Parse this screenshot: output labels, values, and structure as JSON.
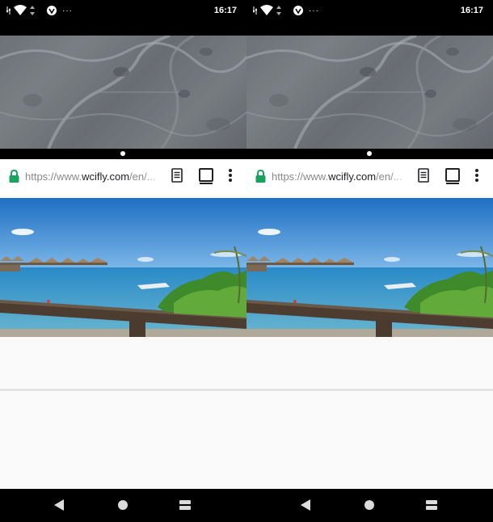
{
  "panes": [
    {
      "status_bar": {
        "time": "16:17",
        "overflow": "···",
        "icons": [
          "wifi-icon",
          "data-arrows-icon",
          "signal-icon",
          "vpn-shield-icon"
        ]
      },
      "toolbar": {
        "url_prefix": "https://www.",
        "url_domain": "wcifly.com",
        "url_path": "/en/...",
        "icons": [
          "lock-icon",
          "reader-mode-icon",
          "tab-switcher-icon",
          "more-menu-icon"
        ]
      },
      "navigation": {
        "icons": [
          "back-icon",
          "home-icon",
          "recents-icon"
        ]
      }
    },
    {
      "status_bar": {
        "time": "16:17",
        "overflow": "···",
        "icons": [
          "wifi-icon",
          "data-arrows-icon",
          "signal-icon",
          "vpn-shield-icon"
        ]
      },
      "toolbar": {
        "url_prefix": "https://www.",
        "url_domain": "wcifly.com",
        "url_path": "/en/...",
        "icons": [
          "lock-icon",
          "reader-mode-icon",
          "tab-switcher-icon",
          "more-menu-icon"
        ]
      },
      "navigation": {
        "icons": [
          "back-icon",
          "home-icon",
          "recents-icon"
        ]
      }
    }
  ],
  "colors": {
    "lock": "#1aa260",
    "status_bar": "#000000",
    "toolbar": "#ffffff",
    "content": "#fafafa",
    "url_text": "#8a8a8a",
    "url_domain": "#202124"
  }
}
